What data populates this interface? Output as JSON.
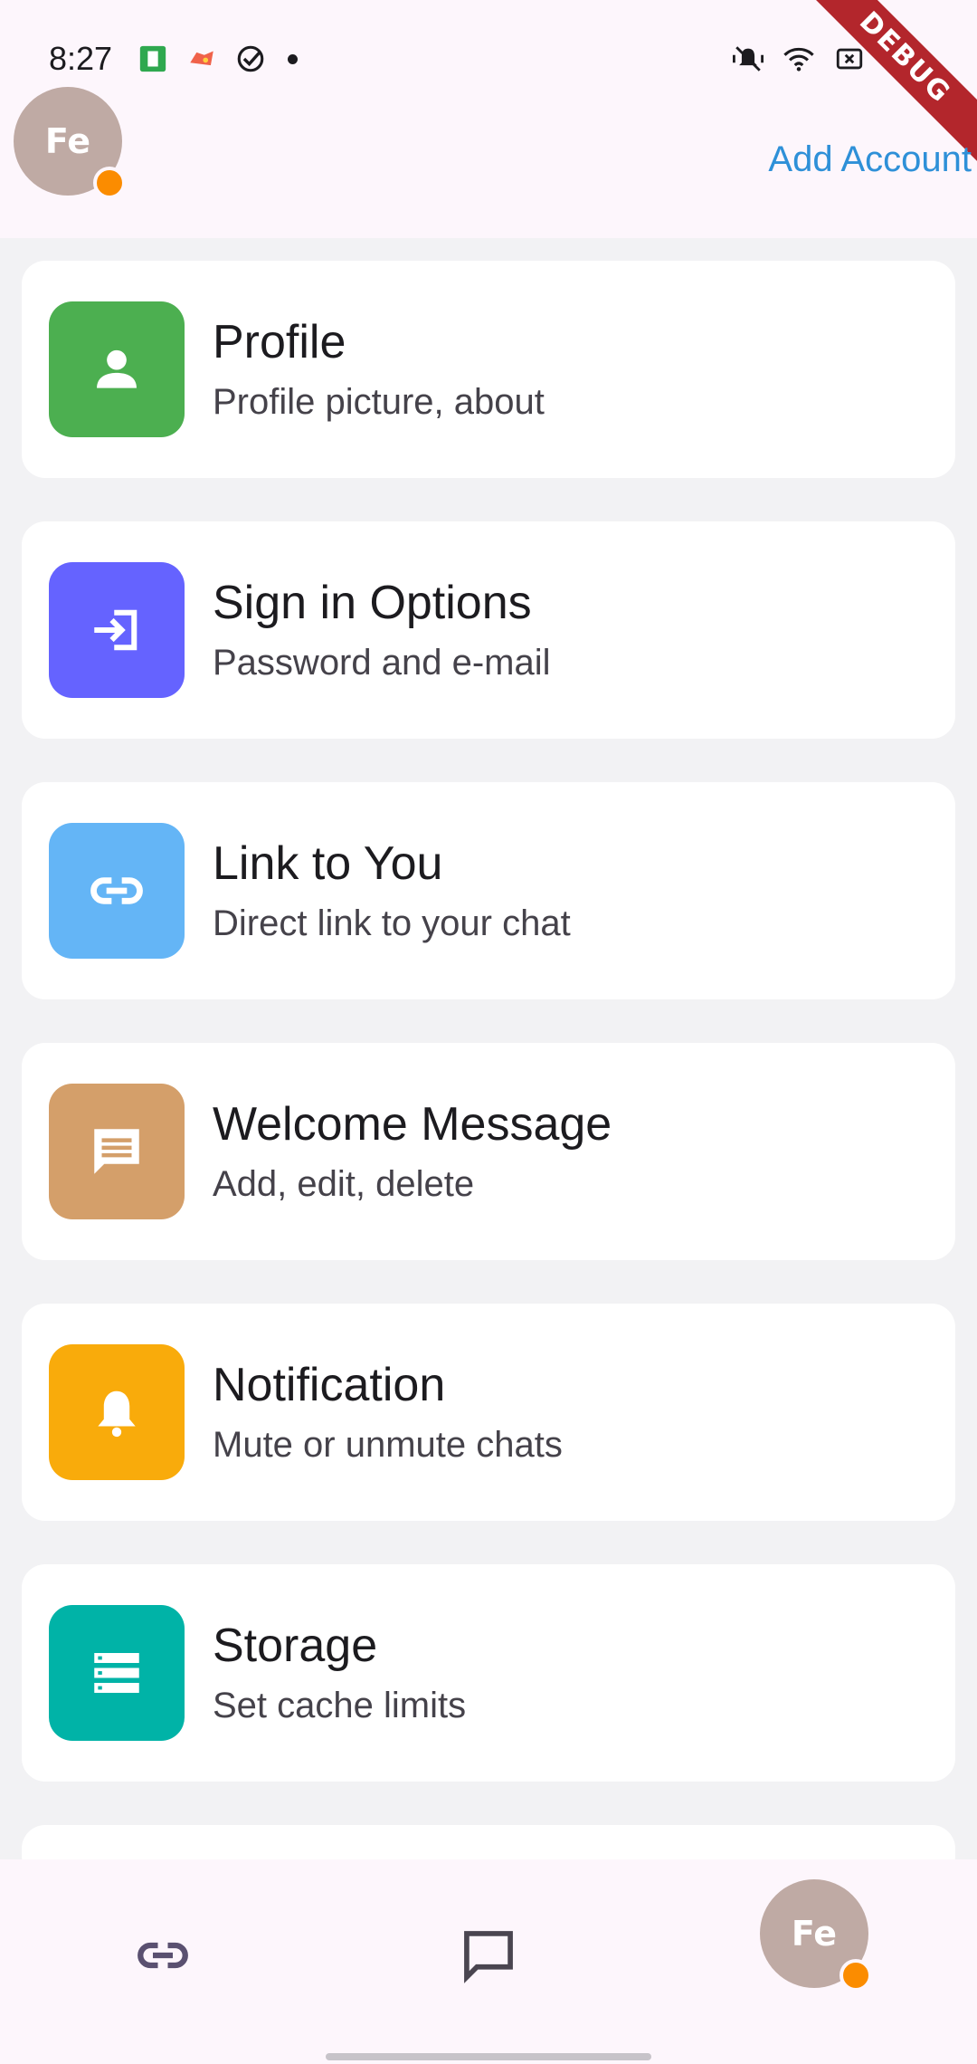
{
  "status_bar": {
    "time": "8:27"
  },
  "debug_label": "DEBUG",
  "header": {
    "avatar_initials": "Fe",
    "add_account_label": "Add Account"
  },
  "settings_items": [
    {
      "title": "Profile",
      "subtitle": "Profile picture, about",
      "icon": "person-icon",
      "color": "#4caf50"
    },
    {
      "title": "Sign in Options",
      "subtitle": "Password and e-mail",
      "icon": "login-icon",
      "color": "#6563ff"
    },
    {
      "title": "Link to You",
      "subtitle": "Direct link to your chat",
      "icon": "link-icon",
      "color": "#64b5f6"
    },
    {
      "title": "Welcome Message",
      "subtitle": "Add, edit, delete",
      "icon": "message-icon",
      "color": "#d49f6a"
    },
    {
      "title": "Notification",
      "subtitle": "Mute or unmute chats",
      "icon": "bell-icon",
      "color": "#f9ab0b"
    },
    {
      "title": "Storage",
      "subtitle": "Set cache limits",
      "icon": "storage-icon",
      "color": "#00b3a7"
    }
  ],
  "bottom_nav": {
    "avatar_initials": "Fe",
    "items": [
      "link-icon",
      "chat-icon",
      "profile-avatar"
    ]
  },
  "colors": {
    "accent": "#2e90d8",
    "presence": "#fb8c00",
    "avatar_bg": "#bfaaa4"
  }
}
